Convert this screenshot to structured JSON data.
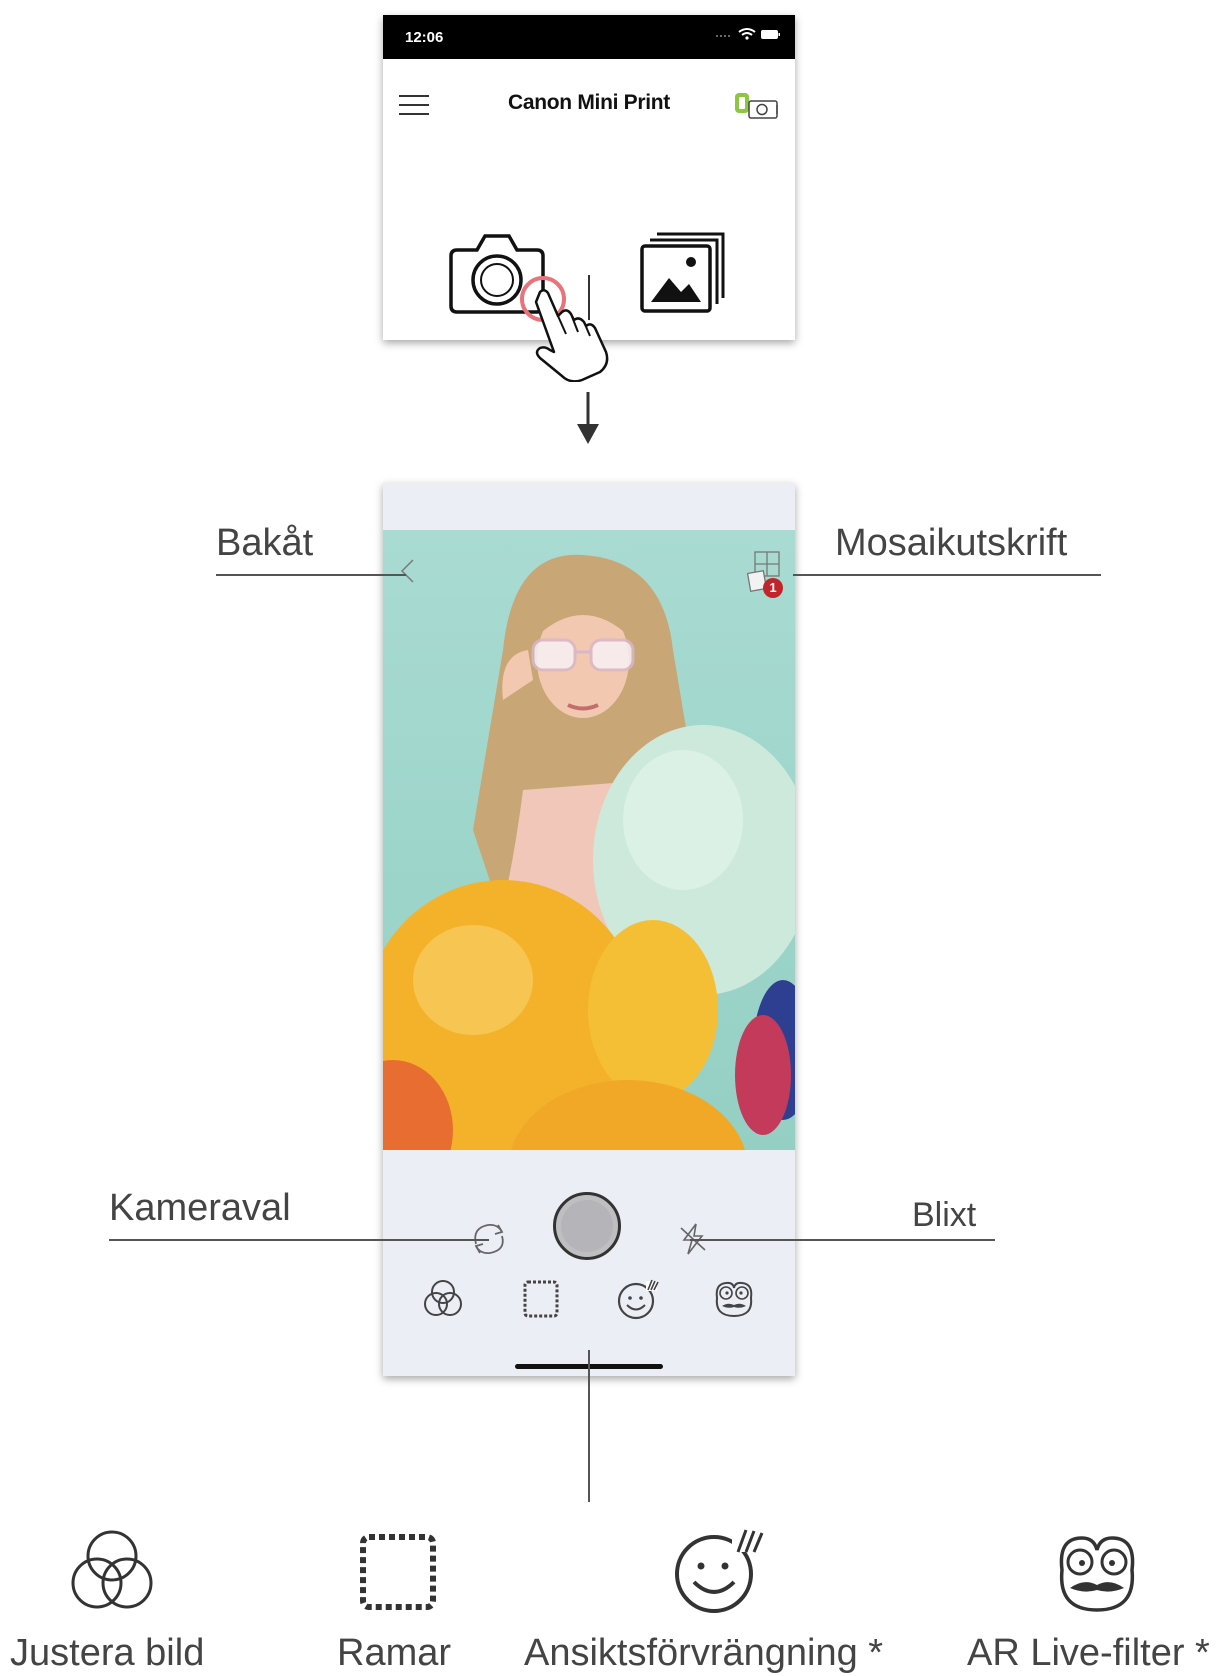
{
  "home_screen": {
    "status_time": "12:06",
    "app_title": "Canon Mini Print",
    "icons": [
      "hamburger-menu-icon",
      "printer-status-icon",
      "camera-icon",
      "gallery-icon"
    ]
  },
  "camera_screen": {
    "collage_badge": "1",
    "icons": [
      "back-chevron-icon",
      "collage-icon",
      "switch-camera-icon",
      "shutter-button",
      "flash-off-icon"
    ]
  },
  "callouts": {
    "back": "Bakåt",
    "collage": "Mosaikutskrift",
    "camera_select": "Kameraval",
    "flash": "Blixt"
  },
  "legend": [
    {
      "label": "Justera bild",
      "icon": "adjust-image-icon"
    },
    {
      "label": "Ramar",
      "icon": "frames-icon"
    },
    {
      "label": "Ansiktsförvrängning *",
      "icon": "face-warp-icon"
    },
    {
      "label": "AR Live-filter *",
      "icon": "ar-live-filter-icon"
    }
  ],
  "colors": {
    "viewfinder_bg": "#9fd6cc",
    "camera_panel_bg": "#eceef5",
    "badge": "#c2242b",
    "battery_green": "#8dc63f",
    "tap_highlight": "#e8737a"
  }
}
